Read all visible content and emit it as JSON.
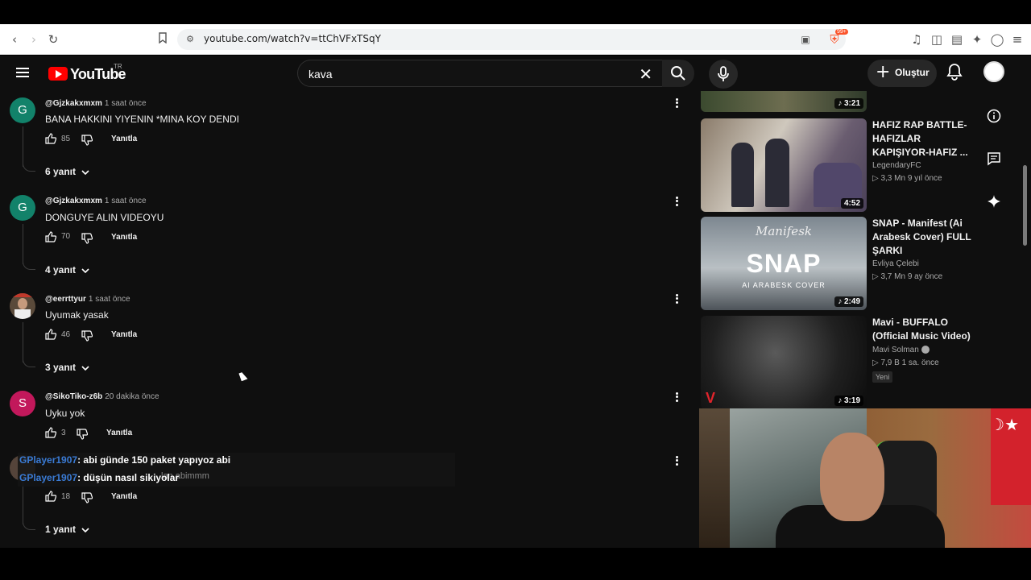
{
  "browser": {
    "url": "youtube.com/watch?v=ttChVFxTSqY",
    "extension_badge": "99+"
  },
  "header": {
    "logo_text": "YouTube",
    "country": "TR",
    "search_value": "kava",
    "create_label": "Oluştur"
  },
  "comments": [
    {
      "avatar_letter": "G",
      "avatar_color": "#12826a",
      "user": "@Gjzkakxmxm",
      "time": "1 saat önce",
      "text": "BANA HAKKINI YIYENIN *MINA KOY DENDI",
      "likes": "85",
      "reply_label": "Yanıtla",
      "replies": "6 yanıt"
    },
    {
      "avatar_letter": "G",
      "avatar_color": "#12826a",
      "user": "@Gjzkakxmxm",
      "time": "1 saat önce",
      "text": "DONGUYE ALIN VIDEOYU",
      "likes": "70",
      "reply_label": "Yanıtla",
      "replies": "4 yanıt"
    },
    {
      "avatar_letter": "",
      "avatar_color": "#5a4a3a",
      "user": "@eerrttyur",
      "time": "1 saat önce",
      "text": "Uyumak yasak",
      "likes": "46",
      "reply_label": "Yanıtla",
      "replies": "3 yanıt"
    },
    {
      "avatar_letter": "S",
      "avatar_color": "#c2185b",
      "user": "@SikoTiko-z6b",
      "time": "20 dakika önce",
      "text": "Uyku yok",
      "likes": "3",
      "reply_label": "Yanıtla",
      "replies": ""
    },
    {
      "avatar_letter": "",
      "avatar_color": "#55443a",
      "user": "",
      "time": "",
      "text": "",
      "likes": "18",
      "reply_label": "Yanıtla",
      "replies": "1 yanıt"
    }
  ],
  "chat_overlay": {
    "line1_name": "GPlayer1907",
    "line1_text": ": abi günde 150 paket yapıyoz abi",
    "line2_name": "GPlayer1907",
    "line2_text": ": düşün nasıl sikiyolar",
    "bg_text": "lan abimmm"
  },
  "sidebar": {
    "top_duration": "3:21",
    "videos": [
      {
        "title": "HAFIZ RAP BATTLE-HAFIZLAR KAPIŞIYOR-HAFIZ ...",
        "channel": "LegendaryFC",
        "meta": "3,3 Mn   9 yıl önce",
        "duration": "4:52",
        "badge": ""
      },
      {
        "title": "SNAP - Manifest (Ai Arabesk Cover) FULL ŞARKI",
        "channel": "Evliya Çelebi",
        "meta": "3,7 Mn   9 ay önce",
        "duration": "2:49",
        "badge": ""
      },
      {
        "title": "Mavi - BUFFALO (Official Music Video)",
        "channel": "Mavi Solman",
        "meta": "7,9 B   1 sa. önce",
        "duration": "3:19",
        "badge": "Yeni"
      }
    ],
    "snap_overlay_title": "SNAP",
    "snap_overlay_sub": "AI ARABESK COVER",
    "snap_overlay_script": "Manifesk"
  },
  "colors": {
    "yt_red": "#ff0000",
    "bg": "#0f0f0f",
    "chat_name": "#3a7bd5"
  }
}
